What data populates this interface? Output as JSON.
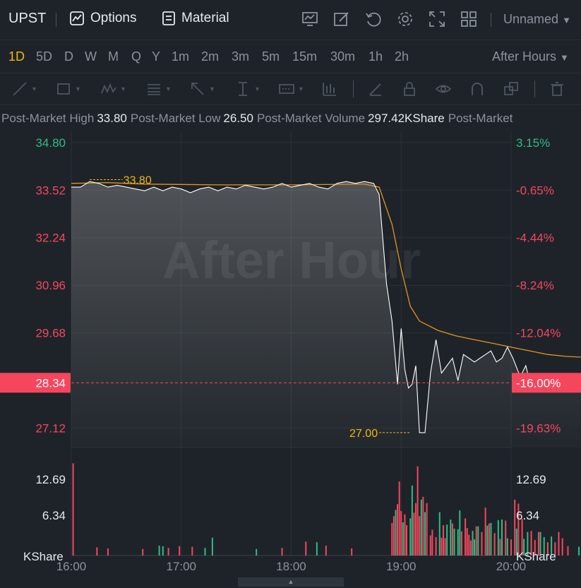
{
  "header": {
    "symbol": "UPST",
    "options_label": "Options",
    "material_label": "Material",
    "layout_name": "Unnamed"
  },
  "intervals": [
    "1D",
    "5D",
    "D",
    "W",
    "M",
    "Q",
    "Y",
    "1m",
    "2m",
    "3m",
    "5m",
    "15m",
    "30m",
    "1h",
    "2h"
  ],
  "active_interval": "1D",
  "session": "After Hours",
  "stats": [
    {
      "label": "Post-Market High",
      "value": "33.80"
    },
    {
      "label": "Post-Market Low",
      "value": "26.50"
    },
    {
      "label": "Post-Market Volume",
      "value": "297.42KShare"
    },
    {
      "label": "Post-Market",
      "value": ""
    }
  ],
  "watermark": "After Hour",
  "colors": {
    "up": "#2ebd85",
    "down": "#f6465d",
    "accent": "#f0b90b",
    "price_line": "#ffffff",
    "avg_line": "#e8931b",
    "current_price_bg": "#f6465d"
  },
  "chart_data": {
    "type": "line",
    "x_ticks": [
      "16:00",
      "17:00",
      "18:00",
      "19:00",
      "20:00"
    ],
    "price_ticks_left": [
      "34.80",
      "33.52",
      "32.24",
      "30.96",
      "29.68",
      "27.12"
    ],
    "percent_ticks_right": [
      "3.15%",
      "-0.65%",
      "-4.44%",
      "-8.24%",
      "-12.04%",
      "-19.63%"
    ],
    "current_price": "28.34",
    "current_percent": "-16.00%",
    "high_marker": "33.80",
    "low_marker": "27.00",
    "ylim": [
      26.6,
      35.1
    ],
    "price_series": {
      "name": "Price",
      "t": [
        0,
        5,
        10,
        15,
        20,
        25,
        30,
        35,
        40,
        45,
        50,
        55,
        60,
        65,
        70,
        75,
        80,
        85,
        90,
        95,
        100,
        105,
        110,
        115,
        120,
        125,
        130,
        135,
        140,
        145,
        150,
        155,
        160,
        165,
        168,
        172,
        175,
        178,
        180,
        182,
        184,
        186,
        188,
        190,
        193,
        196,
        199,
        202,
        205,
        208,
        211,
        214,
        217,
        220,
        223,
        226,
        229,
        232,
        235,
        238,
        241,
        245,
        248,
        250,
        255,
        260,
        265,
        270,
        275,
        278
      ],
      "values": [
        33.6,
        33.6,
        33.75,
        33.7,
        33.6,
        33.65,
        33.6,
        33.55,
        33.5,
        33.6,
        33.5,
        33.6,
        33.55,
        33.45,
        33.55,
        33.6,
        33.5,
        33.6,
        33.55,
        33.65,
        33.6,
        33.55,
        33.6,
        33.7,
        33.6,
        33.65,
        33.7,
        33.6,
        33.55,
        33.7,
        33.75,
        33.7,
        33.75,
        33.7,
        33.4,
        31.0,
        30.0,
        28.3,
        29.8,
        28.7,
        28.2,
        28.3,
        28.8,
        27.0,
        27.0,
        28.6,
        29.5,
        28.6,
        28.8,
        29.0,
        28.4,
        29.1,
        29.0,
        28.9,
        29.0,
        29.1,
        29.2,
        28.9,
        29.0,
        29.3,
        29.0,
        28.5,
        28.8,
        28.4,
        28.2,
        28.3,
        28.2,
        28.3,
        28.4,
        28.34
      ]
    },
    "avg_series": {
      "name": "Average",
      "t": [
        0,
        20,
        40,
        80,
        120,
        160,
        168,
        175,
        180,
        185,
        190,
        200,
        210,
        220,
        230,
        240,
        250,
        260,
        270,
        278
      ],
      "values": [
        33.7,
        33.72,
        33.68,
        33.66,
        33.66,
        33.68,
        33.6,
        32.6,
        31.4,
        30.4,
        30.0,
        29.75,
        29.6,
        29.5,
        29.4,
        29.3,
        29.2,
        29.1,
        29.05,
        29.03
      ]
    },
    "volume_ticks": [
      "12.69",
      "6.34"
    ],
    "volume_unit": "KShare",
    "volume_bars": [
      {
        "t": 1,
        "v": 15.5,
        "up": false
      },
      {
        "t": 14,
        "v": 0.7,
        "up": false
      },
      {
        "t": 20,
        "v": 0.5,
        "up": false
      },
      {
        "t": 39,
        "v": 0.4,
        "up": false
      },
      {
        "t": 48,
        "v": 1.0,
        "up": true
      },
      {
        "t": 50,
        "v": 0.9,
        "up": true
      },
      {
        "t": 53,
        "v": 0.6,
        "up": false
      },
      {
        "t": 59,
        "v": 0.9,
        "up": false
      },
      {
        "t": 66,
        "v": 0.8,
        "up": false
      },
      {
        "t": 73,
        "v": 0.6,
        "up": true
      },
      {
        "t": 77,
        "v": 2.4,
        "up": true
      },
      {
        "t": 101,
        "v": 0.4,
        "up": true
      },
      {
        "t": 115,
        "v": 0.6,
        "up": false
      },
      {
        "t": 128,
        "v": 1.7,
        "up": false
      },
      {
        "t": 134,
        "v": 1.6,
        "up": true
      },
      {
        "t": 139,
        "v": 1.0,
        "up": false
      },
      {
        "t": 153,
        "v": 0.5,
        "up": false
      },
      {
        "t": 175,
        "v": 5.0,
        "up": false
      },
      {
        "t": 176,
        "v": 6.2,
        "up": false
      },
      {
        "t": 177,
        "v": 7.3,
        "up": true
      },
      {
        "t": 178,
        "v": 8.3,
        "up": false
      },
      {
        "t": 179,
        "v": 12.3,
        "up": false
      },
      {
        "t": 180,
        "v": 7.1,
        "up": false
      },
      {
        "t": 181,
        "v": 5.1,
        "up": true
      },
      {
        "t": 182,
        "v": 6.5,
        "up": false
      },
      {
        "t": 183,
        "v": 4.6,
        "up": false
      },
      {
        "t": 185,
        "v": 5.8,
        "up": true
      },
      {
        "t": 186,
        "v": 11.6,
        "up": true
      },
      {
        "t": 187,
        "v": 6.8,
        "up": false
      },
      {
        "t": 188,
        "v": 8.5,
        "up": false
      },
      {
        "t": 189,
        "v": 15.0,
        "up": false
      },
      {
        "t": 190,
        "v": 6.2,
        "up": false
      },
      {
        "t": 191,
        "v": 9.1,
        "up": true
      },
      {
        "t": 192,
        "v": 9.6,
        "up": false
      },
      {
        "t": 193,
        "v": 6.9,
        "up": true
      },
      {
        "t": 194,
        "v": 8.5,
        "up": false
      },
      {
        "t": 196,
        "v": 2.8,
        "up": false
      },
      {
        "t": 197,
        "v": 3.8,
        "up": false
      },
      {
        "t": 199,
        "v": 2.5,
        "up": false
      },
      {
        "t": 201,
        "v": 6.9,
        "up": true
      },
      {
        "t": 202,
        "v": 2.4,
        "up": false
      },
      {
        "t": 203,
        "v": 4.6,
        "up": false
      },
      {
        "t": 204,
        "v": 2.3,
        "up": false
      },
      {
        "t": 205,
        "v": 4.7,
        "up": true
      },
      {
        "t": 207,
        "v": 5.6,
        "up": true
      },
      {
        "t": 208,
        "v": 4.9,
        "up": false
      },
      {
        "t": 209,
        "v": 4.0,
        "up": true
      },
      {
        "t": 211,
        "v": 3.9,
        "up": true
      },
      {
        "t": 212,
        "v": 7.2,
        "up": true
      },
      {
        "t": 213,
        "v": 3.5,
        "up": false
      },
      {
        "t": 215,
        "v": 5.8,
        "up": false
      },
      {
        "t": 216,
        "v": 4.1,
        "up": false
      },
      {
        "t": 217,
        "v": 2.9,
        "up": false
      },
      {
        "t": 218,
        "v": 1.9,
        "up": false
      },
      {
        "t": 219,
        "v": 3.6,
        "up": true
      },
      {
        "t": 220,
        "v": 2.1,
        "up": true
      },
      {
        "t": 221,
        "v": 4.4,
        "up": false
      },
      {
        "t": 222,
        "v": 4.4,
        "up": true
      },
      {
        "t": 224,
        "v": 3.4,
        "up": false
      },
      {
        "t": 226,
        "v": 7.7,
        "up": false
      },
      {
        "t": 227,
        "v": 4.5,
        "up": true
      },
      {
        "t": 228,
        "v": 4.9,
        "up": false
      },
      {
        "t": 229,
        "v": 5.0,
        "up": true
      },
      {
        "t": 231,
        "v": 3.2,
        "up": false
      },
      {
        "t": 233,
        "v": 5.5,
        "up": true
      },
      {
        "t": 234,
        "v": 2.2,
        "up": false
      },
      {
        "t": 235,
        "v": 5.6,
        "up": true
      },
      {
        "t": 237,
        "v": 5.4,
        "up": false
      },
      {
        "t": 238,
        "v": 2.3,
        "up": true
      },
      {
        "t": 240,
        "v": 2.1,
        "up": false
      },
      {
        "t": 242,
        "v": 9.1,
        "up": false
      },
      {
        "t": 243,
        "v": 4.0,
        "up": true
      },
      {
        "t": 244,
        "v": 8.4,
        "up": false
      },
      {
        "t": 246,
        "v": 5.7,
        "up": false
      },
      {
        "t": 247,
        "v": 2.2,
        "up": true
      },
      {
        "t": 249,
        "v": 3.4,
        "up": true
      },
      {
        "t": 251,
        "v": 3.6,
        "up": false
      },
      {
        "t": 253,
        "v": 2.0,
        "up": false
      },
      {
        "t": 255,
        "v": 3.4,
        "up": false
      },
      {
        "t": 256,
        "v": 3.4,
        "up": true
      },
      {
        "t": 258,
        "v": 2.5,
        "up": true
      },
      {
        "t": 260,
        "v": 1.6,
        "up": false
      },
      {
        "t": 262,
        "v": 2.6,
        "up": true
      },
      {
        "t": 264,
        "v": 1.6,
        "up": false
      },
      {
        "t": 266,
        "v": 3.4,
        "up": false
      },
      {
        "t": 268,
        "v": 2.3,
        "up": false
      },
      {
        "t": 271,
        "v": 0.9,
        "up": false
      },
      {
        "t": 277,
        "v": 0.8,
        "up": true
      }
    ]
  }
}
